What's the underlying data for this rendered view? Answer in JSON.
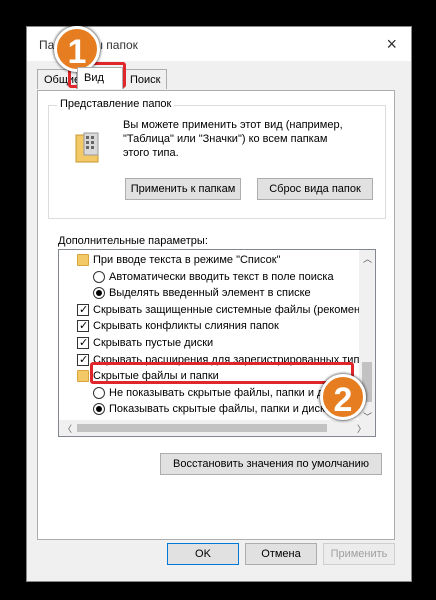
{
  "window": {
    "title": "Параметры папок",
    "close_icon": "×"
  },
  "tabs": [
    {
      "label": "Общие"
    },
    {
      "label": "Вид"
    },
    {
      "label": "Поиск"
    }
  ],
  "folder_view": {
    "legend": "Представление папок",
    "description_line1": "Вы можете применить этот вид (например,",
    "description_line2": "\"Таблица\" или \"Значки\") ко всем папкам",
    "description_line3": "этого типа.",
    "apply_button": "Применить к папкам",
    "reset_button": "Сброс вида папок"
  },
  "advanced": {
    "label": "Дополнительные параметры:",
    "items": [
      {
        "type": "folder",
        "text": "При вводе текста в режиме \"Список\""
      },
      {
        "type": "radio",
        "checked": false,
        "text": "Автоматически вводить текст в поле поиска"
      },
      {
        "type": "radio",
        "checked": true,
        "text": "Выделять введенный элемент в списке"
      },
      {
        "type": "checkbox",
        "checked": true,
        "text": "Скрывать защищенные системные файлы (рекомен"
      },
      {
        "type": "checkbox",
        "checked": true,
        "text": "Скрывать конфликты слияния папок"
      },
      {
        "type": "checkbox",
        "checked": true,
        "text": "Скрывать пустые диски"
      },
      {
        "type": "checkbox",
        "checked": true,
        "text": "Скрывать расширения для зарегистрированных типо"
      },
      {
        "type": "folder",
        "text": "Скрытые файлы и папки"
      },
      {
        "type": "radio",
        "checked": false,
        "text": "Не показывать скрытые файлы, папки и диски"
      },
      {
        "type": "radio",
        "checked": true,
        "text": "Показывать скрытые файлы, папки и диски"
      }
    ]
  },
  "restore_button": "Восстановить значения по умолчанию",
  "footer": {
    "ok": "OK",
    "cancel": "Отмена",
    "apply": "Применить"
  },
  "annotations": {
    "step1": "1",
    "step2": "2"
  },
  "colors": {
    "marker": "#e67d20",
    "highlight": "#e0262a",
    "accent": "#0078d7"
  }
}
